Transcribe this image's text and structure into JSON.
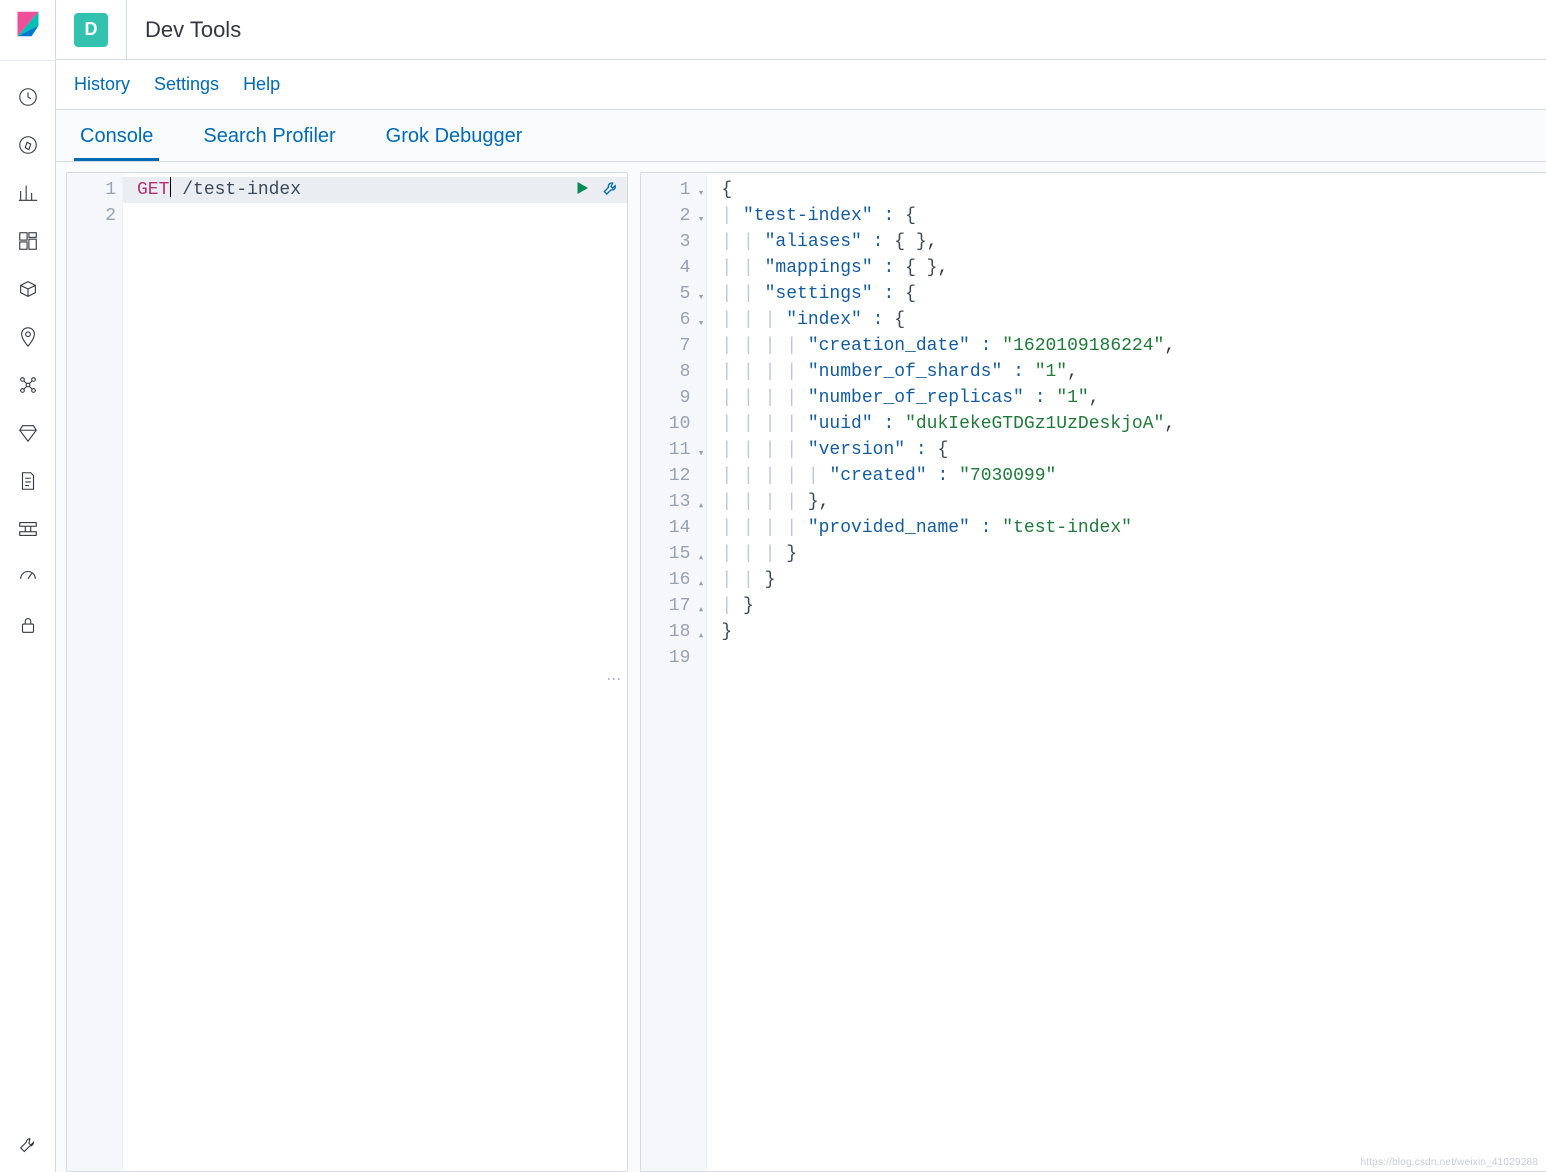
{
  "header": {
    "badge_letter": "D",
    "title": "Dev Tools"
  },
  "toolbar": {
    "history": "History",
    "settings": "Settings",
    "help": "Help"
  },
  "tabs": {
    "console": "Console",
    "search_profiler": "Search Profiler",
    "grok_debugger": "Grok Debugger"
  },
  "request": {
    "method": "GET",
    "path": "/test-index",
    "line_numbers": [
      "1",
      "2"
    ]
  },
  "response": {
    "line_numbers": [
      "1",
      "2",
      "3",
      "4",
      "5",
      "6",
      "7",
      "8",
      "9",
      "10",
      "11",
      "12",
      "13",
      "14",
      "15",
      "16",
      "17",
      "18",
      "19"
    ],
    "fold_open_lines": [
      1,
      2,
      5,
      6,
      11
    ],
    "fold_close_lines": [
      13,
      15,
      16,
      17,
      18
    ],
    "json": {
      "root_key": "test-index",
      "aliases_key": "aliases",
      "mappings_key": "mappings",
      "settings_key": "settings",
      "index_key": "index",
      "creation_date_key": "creation_date",
      "creation_date_val": "1620109186224",
      "shards_key": "number_of_shards",
      "shards_val": "1",
      "replicas_key": "number_of_replicas",
      "replicas_val": "1",
      "uuid_key": "uuid",
      "uuid_val": "dukIekeGTDGz1UzDeskjoA",
      "version_key": "version",
      "created_key": "created",
      "created_val": "7030099",
      "provided_name_key": "provided_name",
      "provided_name_val": "test-index"
    }
  },
  "watermark": "https://blog.csdn.net/weixin_41029288"
}
